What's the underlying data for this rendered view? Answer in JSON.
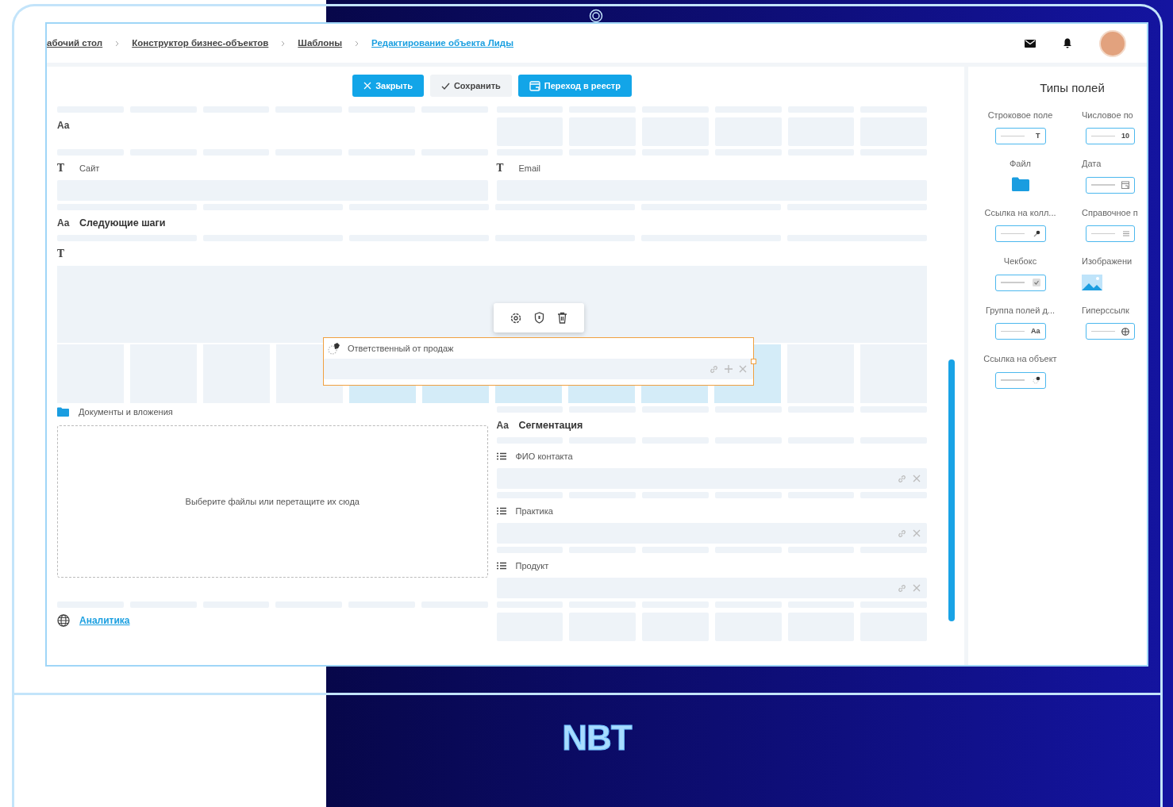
{
  "breadcrumbs": [
    {
      "label": "абочий стол",
      "current": false
    },
    {
      "label": "Конструктор бизнес-объектов",
      "current": false
    },
    {
      "label": "Шаблоны",
      "current": false
    },
    {
      "label": "Редактирование объекта Лиды",
      "current": true
    }
  ],
  "toolbar": [
    {
      "label": "Закрыть",
      "kind": "primary"
    },
    {
      "label": "Сохранить",
      "kind": "secondary"
    },
    {
      "label": "Переход в реестр",
      "kind": "primary"
    }
  ],
  "canvas": {
    "rows": [
      {
        "kind": "split",
        "left": [
          {
            "kind": "heading",
            "glyph": "Aa"
          }
        ],
        "right": []
      },
      {
        "kind": "split",
        "left": [
          {
            "kind": "text",
            "glyph": "T",
            "label": "Сайт"
          }
        ],
        "right": [
          {
            "kind": "text",
            "glyph": "T",
            "label": "Email"
          }
        ]
      },
      {
        "kind": "full",
        "fields": [
          {
            "kind": "heading",
            "glyph": "Aa",
            "label": "Следующие шаги"
          }
        ]
      },
      {
        "kind": "full",
        "fields": [
          {
            "kind": "textarea",
            "glyph": "T"
          }
        ]
      },
      {
        "kind": "drop",
        "dragged": {
          "label": "Ответственный от продаж"
        }
      },
      {
        "kind": "split",
        "left": [
          {
            "kind": "files",
            "label": "Документы и вложения",
            "hint": "Выберите файлы или перетащите их сюда"
          }
        ],
        "right": [
          {
            "kind": "heading",
            "glyph": "Aa",
            "label": "Сегментация"
          },
          {
            "kind": "list",
            "label": "ФИО контакта"
          },
          {
            "kind": "list",
            "label": "Практика"
          },
          {
            "kind": "list",
            "label": "Продукт"
          }
        ]
      },
      {
        "kind": "split",
        "left": [
          {
            "kind": "link",
            "label": "Аналитика"
          }
        ],
        "right": []
      }
    ]
  },
  "panel": {
    "title": "Типы полей",
    "items": [
      {
        "label": "Строковое поле",
        "kind": "input",
        "glyph": "T"
      },
      {
        "label": "Числовое по",
        "kind": "input",
        "glyph": "10"
      },
      {
        "label": "Файл",
        "kind": "file"
      },
      {
        "label": "Дата",
        "kind": "date"
      },
      {
        "label": "Ссылка на колл...",
        "kind": "collection-link"
      },
      {
        "label": "Справочное п",
        "kind": "reference"
      },
      {
        "label": "Чекбокс",
        "kind": "checkbox"
      },
      {
        "label": "Изображени",
        "kind": "image"
      },
      {
        "label": "Группа полей д...",
        "kind": "input",
        "glyph": "Aa"
      },
      {
        "label": "Гиперссылк",
        "kind": "hyperlink"
      },
      {
        "label": "Ссылка на объект",
        "kind": "object-link"
      }
    ]
  },
  "brand": "NBT"
}
